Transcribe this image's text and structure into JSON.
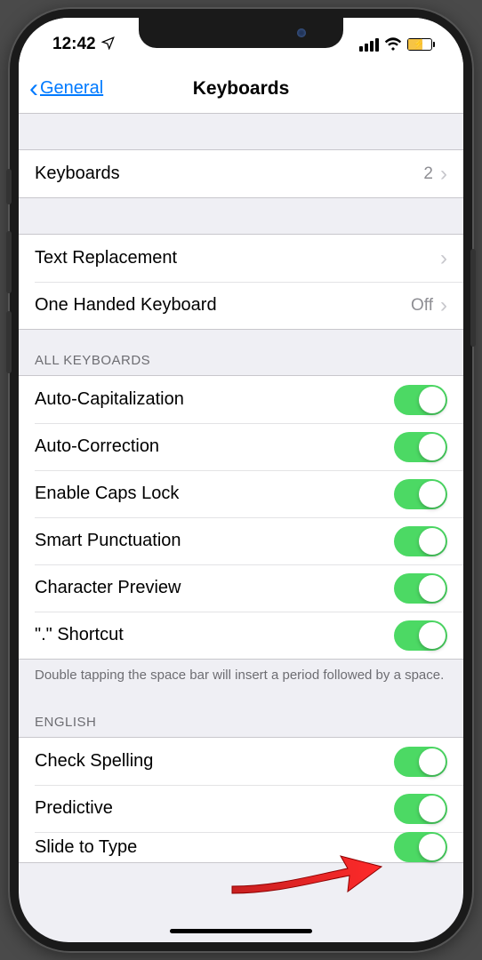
{
  "status": {
    "time": "12:42"
  },
  "nav": {
    "back": "General",
    "title": "Keyboards"
  },
  "section1": {
    "keyboards": {
      "label": "Keyboards",
      "count": "2"
    }
  },
  "section2": {
    "textReplacement": {
      "label": "Text Replacement"
    },
    "oneHanded": {
      "label": "One Handed Keyboard",
      "value": "Off"
    }
  },
  "allKeyboards": {
    "header": "ALL KEYBOARDS",
    "items": [
      {
        "label": "Auto-Capitalization"
      },
      {
        "label": "Auto-Correction"
      },
      {
        "label": "Enable Caps Lock"
      },
      {
        "label": "Smart Punctuation"
      },
      {
        "label": "Character Preview"
      },
      {
        "label": "\".\" Shortcut"
      }
    ],
    "footer": "Double tapping the space bar will insert a period followed by a space."
  },
  "english": {
    "header": "ENGLISH",
    "items": [
      {
        "label": "Check Spelling"
      },
      {
        "label": "Predictive"
      },
      {
        "label": "Slide to Type"
      }
    ]
  }
}
